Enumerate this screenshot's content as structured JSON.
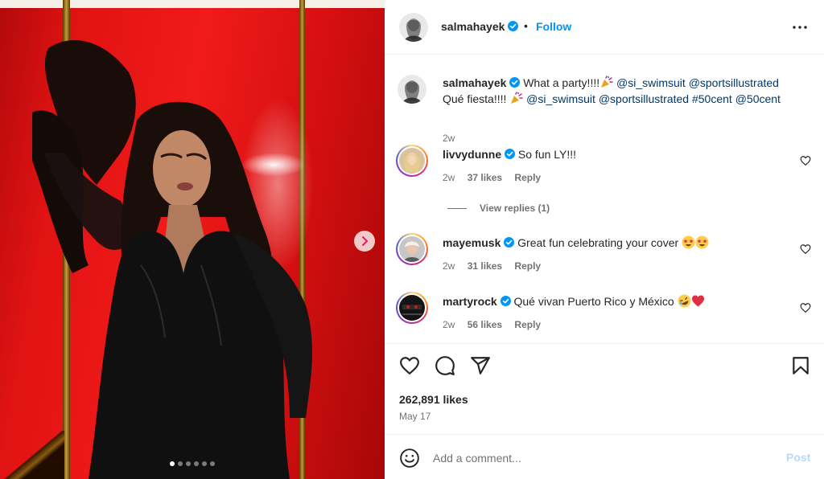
{
  "post": {
    "username": "salmahayek",
    "follow_label": "Follow",
    "separator": "•",
    "more_icon": "more-horizontal-icon",
    "carousel": {
      "total": 6,
      "active_index": 0,
      "next_icon": "chevron-right-icon"
    }
  },
  "caption": {
    "username": "salmahayek",
    "line1_text": "What a party!!!!",
    "line1_mentions": [
      "@si_swimsuit",
      "@sportsillustrated"
    ],
    "line2_text": "Qué fiesta!!!!",
    "line2_mentions": [
      "@si_swimsuit",
      "@sportsillustrated",
      "#50cent",
      "@50cent"
    ],
    "time": "2w",
    "emoji_icon": "party-popper-icon"
  },
  "comments": [
    {
      "username": "livvydunne",
      "text": "So fun LY!!!",
      "time": "2w",
      "likes": "37 likes",
      "reply_label": "Reply",
      "has_story_ring": true
    },
    {
      "username": "mayemusk",
      "text": "Great fun celebrating your cover",
      "time": "2w",
      "likes": "31 likes",
      "reply_label": "Reply",
      "has_story_ring": true,
      "emojis": [
        "star-struck-emoji",
        "star-struck-emoji"
      ]
    },
    {
      "username": "martyrock",
      "text": "Qué vivan Puerto Rico y México",
      "time": "2w",
      "likes": "56 likes",
      "reply_label": "Reply",
      "has_story_ring": true,
      "emojis": [
        "rofl-emoji",
        "red-heart-emoji"
      ]
    }
  ],
  "view_replies_label": "View replies (1)",
  "engagement": {
    "likes": "262,891 likes",
    "date": "May 17"
  },
  "add_comment": {
    "placeholder": "Add a comment...",
    "post_label": "Post"
  },
  "colors": {
    "accent": "#0095f6",
    "link": "#00376b",
    "muted": "#737373",
    "post_disabled": "#b3dbff",
    "verified": "#0095f6"
  }
}
